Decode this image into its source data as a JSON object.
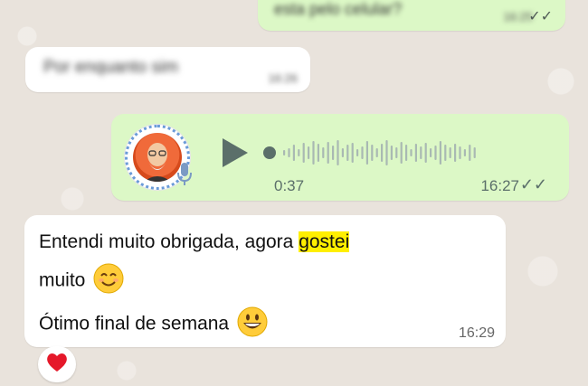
{
  "chat": {
    "messages": [
      {
        "direction": "outgoing",
        "text": "esta pelo celular?",
        "time": "16:25",
        "ticks": "✓✓",
        "blurred": true
      },
      {
        "direction": "incoming",
        "text": "Por enquanto sim",
        "time": "16:26",
        "blurred": true
      },
      {
        "direction": "outgoing",
        "type": "voice",
        "duration": "0:37",
        "time": "16:27",
        "ticks": "✓✓"
      },
      {
        "direction": "incoming",
        "line1_a": "Entendi muito obrigada, agora ",
        "line1_highlight": "gostei",
        "line2": "muito",
        "line3": "Ótimo final de semana",
        "time": "16:29",
        "reaction": "heart-icon"
      }
    ]
  },
  "colors": {
    "outgoing_bubble": "#dcf8c6",
    "incoming_bubble": "#ffffff",
    "background": "#e9e3dc",
    "highlight": "#ffef00",
    "voice_controls": "#5b6f6a"
  },
  "icons": [
    "double-check-icon",
    "play-icon",
    "mic-icon",
    "smiling-face-emoji",
    "grinning-face-emoji",
    "heart-icon",
    "avatar"
  ]
}
